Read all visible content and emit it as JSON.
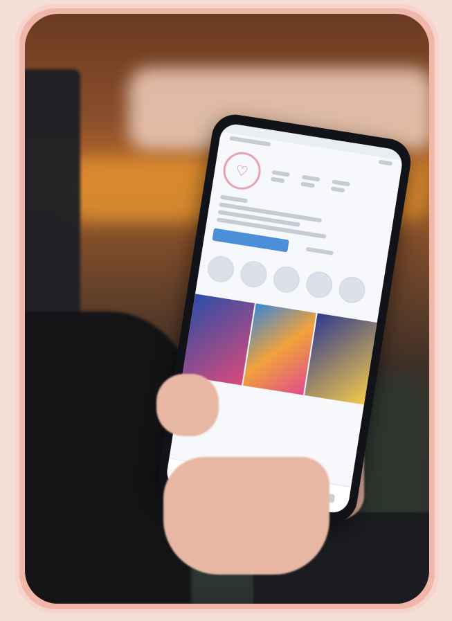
{
  "scene": {
    "description_label": "",
    "accent_color": "#f0b7a8",
    "background_color": "#f3dfd6"
  },
  "phone_ui": {
    "profile_name": "",
    "stats": [
      "",
      "",
      ""
    ],
    "bio": "",
    "follow_label": ""
  }
}
